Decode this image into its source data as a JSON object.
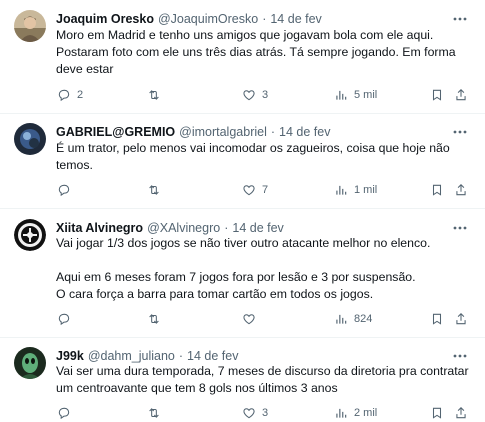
{
  "tweets": [
    {
      "name": "Joaquim Oresko",
      "handle": "@JoaquimOresko",
      "separator": "·",
      "date": "14 de fev",
      "lines": [
        "Moro em Madrid e tenho uns amigos que jogavam bola com ele aqui.",
        "Postaram foto com ele uns três dias atrás. Tá sempre jogando. Em forma",
        "deve estar"
      ],
      "replies": "2",
      "retweets": "",
      "likes": "3",
      "views": "5 mil"
    },
    {
      "name": "GABRIEL@GREMIO",
      "handle": "@imortalgabriel",
      "separator": "·",
      "date": "14 de fev",
      "lines": [
        "É um trator, pelo menos vai incomodar os zagueiros, coisa que hoje não",
        "temos."
      ],
      "replies": "",
      "retweets": "",
      "likes": "7",
      "views": "1 mil"
    },
    {
      "name": "Xiita Alvinegro",
      "handle": "@XAlvinegro",
      "separator": "·",
      "date": "14 de fev",
      "lines": [
        "Vai jogar 1/3 dos jogos se não tiver outro atacante melhor no elenco.",
        "",
        "Aqui em 6 meses foram 7 jogos fora por lesão e 3 por suspensão.",
        "O cara força a barra para tomar cartão em todos os jogos."
      ],
      "replies": "",
      "retweets": "",
      "likes": "",
      "views": "824"
    },
    {
      "name": "J99k",
      "handle": "@dahm_juliano",
      "separator": "·",
      "date": "14 de fev",
      "lines": [
        "Vai ser uma dura temporada, 7 meses de discurso da diretoria pra contratar",
        "um centroavante que tem 8 gols nos últimos 3 anos"
      ],
      "replies": "",
      "retweets": "",
      "likes": "3",
      "views": "2 mil"
    }
  ],
  "icons": {
    "more": "more-horizontal-icon",
    "reply": "reply-icon",
    "retweet": "retweet-icon",
    "like": "heart-icon",
    "views": "views-chart-icon",
    "bookmark": "bookmark-icon",
    "share": "share-icon"
  },
  "colors": {
    "text": "#0f1419",
    "secondary": "#536471",
    "divider": "#eff3f4"
  }
}
